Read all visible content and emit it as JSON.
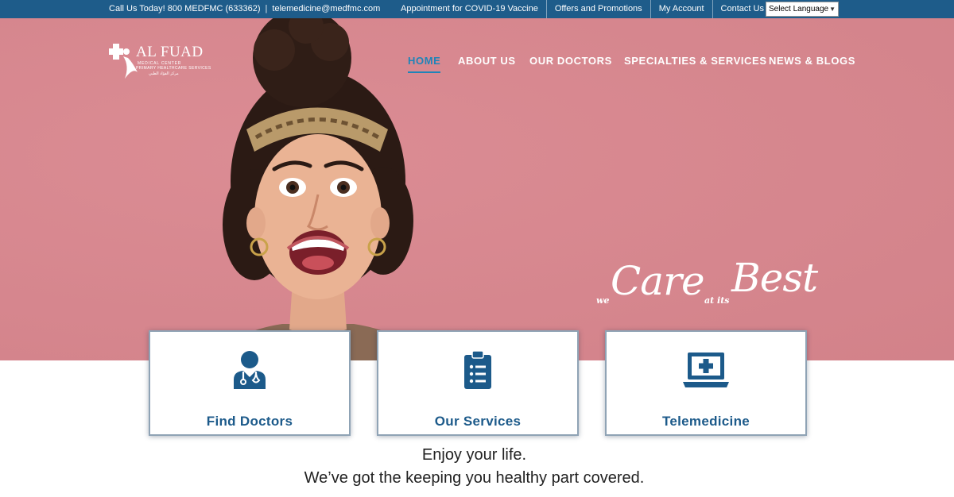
{
  "topbar": {
    "phone": "Call Us Today! 800 MEDFMC (633362)",
    "separator": "|",
    "email": "telemedicine@medfmc.com",
    "links": [
      {
        "label": "Appointment for COVID-19 Vaccine"
      },
      {
        "label": "Offers and Promotions"
      },
      {
        "label": "My Account"
      },
      {
        "label": "Contact Us"
      }
    ],
    "language_select": {
      "value": "Select Language",
      "arrow": "▼"
    }
  },
  "logo": {
    "name": "AL FUAD",
    "line1": "MEDICAL CENTER",
    "line2": "PRIMARY HEALTHCARE SERVICES",
    "line3": "مركز الفؤاد الطبي"
  },
  "nav": {
    "items": [
      {
        "label": "HOME",
        "active": true
      },
      {
        "label": "ABOUT US"
      },
      {
        "label": "OUR DOCTORS"
      },
      {
        "label": "SPECIALTIES & SERVICES"
      },
      {
        "label": "NEWS & BLOGS"
      }
    ]
  },
  "hero": {
    "tagline": {
      "we": "we",
      "care": "Care",
      "at_its": "at its",
      "best": "Best"
    }
  },
  "cards": [
    {
      "label": "Find Doctors",
      "icon": "doctor-icon"
    },
    {
      "label": "Our Services",
      "icon": "clipboard-list-icon"
    },
    {
      "label": "Telemedicine",
      "icon": "laptop-medical-icon"
    }
  ],
  "intro": {
    "line1": "Enjoy your life.",
    "line2": "We’ve got the keeping you healthy part covered."
  },
  "colors": {
    "topbar": "#1e5c8a",
    "hero_bg": "#d9868e",
    "accent": "#1f84b8",
    "card_text": "#1c5a8a",
    "icon": "#1c5a8a"
  }
}
